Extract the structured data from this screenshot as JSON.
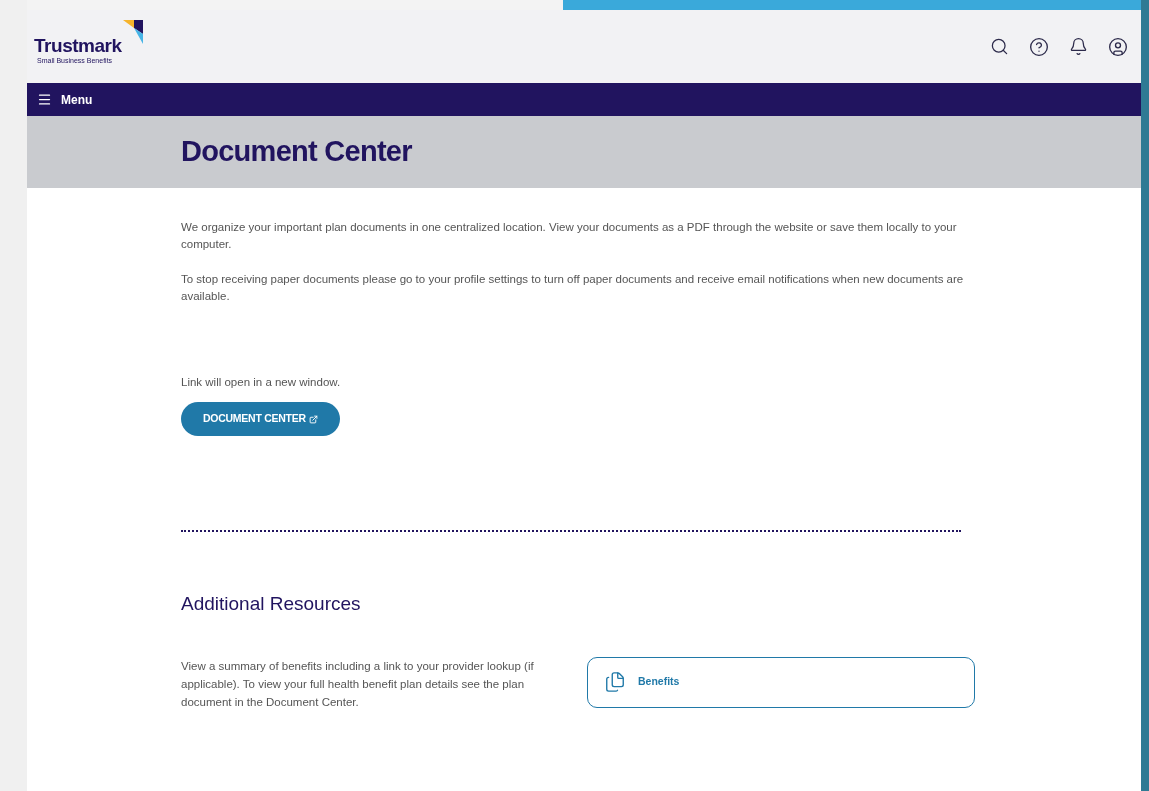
{
  "header": {
    "logo": {
      "name": "Trustmark",
      "tagline": "Small Business Benefits"
    }
  },
  "nav": {
    "menu_label": "Menu"
  },
  "page_title": "Document Center",
  "intro_paragraphs": [
    "We organize your important plan documents in one centralized location. View your documents as a PDF through the website or save them locally to your computer.",
    "To stop receiving paper documents please go to your profile settings to turn off paper documents and receive email notifications when new documents are available."
  ],
  "link_note": "Link will open in a new window.",
  "document_button": {
    "label": "DOCUMENT CENTER"
  },
  "additional_resources": {
    "heading": "Additional Resources",
    "description": "View a summary of benefits including a link to your provider lookup (if applicable). To view your full health benefit plan details see the plan document in the Document Center.",
    "card": {
      "label": "Benefits"
    }
  }
}
